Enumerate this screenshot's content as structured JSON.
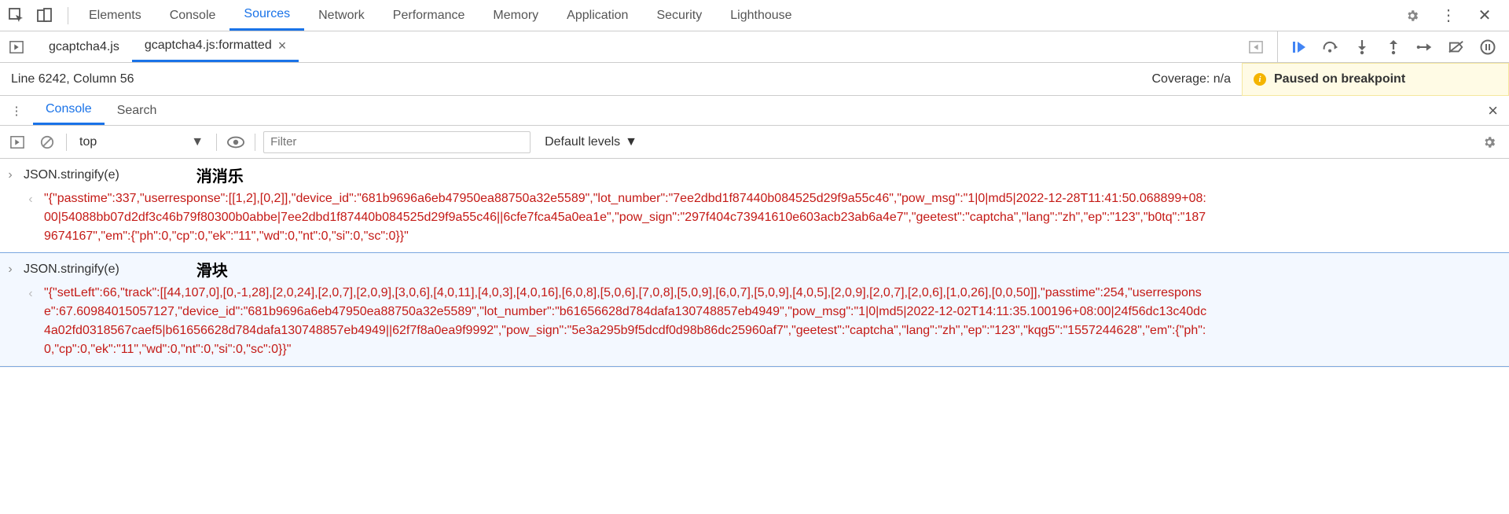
{
  "mainTabs": {
    "elements": "Elements",
    "console": "Console",
    "sources": "Sources",
    "network": "Network",
    "performance": "Performance",
    "memory": "Memory",
    "application": "Application",
    "security": "Security",
    "lighthouse": "Lighthouse"
  },
  "fileTabs": {
    "tab1": "gcaptcha4.js",
    "tab2": "gcaptcha4.js:formatted"
  },
  "status": {
    "lineCol": "Line 6242, Column 56",
    "coverage": "Coverage: n/a"
  },
  "pausedBanner": "Paused on breakpoint",
  "drawerTabs": {
    "console": "Console",
    "search": "Search"
  },
  "consoleToolbar": {
    "context": "top",
    "filterPlaceholder": "Filter",
    "levels": "Default levels"
  },
  "logs": [
    {
      "input": "JSON.stringify(e)",
      "annotation": "消消乐",
      "output": "\"{\"passtime\":337,\"userresponse\":[[1,2],[0,2]],\"device_id\":\"681b9696a6eb47950ea88750a32e5589\",\"lot_number\":\"7ee2dbd1f87440b084525d29f9a55c46\",\"pow_msg\":\"1|0|md5|2022-12-28T11:41:50.068899+08:00|54088bb07d2df3c46b79f80300b0abbe|7ee2dbd1f87440b084525d29f9a55c46||6cfe7fca45a0ea1e\",\"pow_sign\":\"297f404c73941610e603acb23ab6a4e7\",\"geetest\":\"captcha\",\"lang\":\"zh\",\"ep\":\"123\",\"b0tq\":\"1879674167\",\"em\":{\"ph\":0,\"cp\":0,\"ek\":\"11\",\"wd\":0,\"nt\":0,\"si\":0,\"sc\":0}}\""
    },
    {
      "input": "JSON.stringify(e)",
      "annotation": "滑块",
      "output": "\"{\"setLeft\":66,\"track\":[[44,107,0],[0,-1,28],[2,0,24],[2,0,7],[2,0,9],[3,0,6],[4,0,11],[4,0,3],[4,0,16],[6,0,8],[5,0,6],[7,0,8],[5,0,9],[6,0,7],[5,0,9],[4,0,5],[2,0,9],[2,0,7],[2,0,6],[1,0,26],[0,0,50]],\"passtime\":254,\"userresponse\":67.60984015057127,\"device_id\":\"681b9696a6eb47950ea88750a32e5589\",\"lot_number\":\"b61656628d784dafa130748857eb4949\",\"pow_msg\":\"1|0|md5|2022-12-02T14:11:35.100196+08:00|24f56dc13c40dc4a02fd0318567caef5|b61656628d784dafa130748857eb4949||62f7f8a0ea9f9992\",\"pow_sign\":\"5e3a295b9f5dcdf0d98b86dc25960af7\",\"geetest\":\"captcha\",\"lang\":\"zh\",\"ep\":\"123\",\"kqg5\":\"1557244628\",\"em\":{\"ph\":0,\"cp\":0,\"ek\":\"11\",\"wd\":0,\"nt\":0,\"si\":0,\"sc\":0}}\""
    }
  ]
}
